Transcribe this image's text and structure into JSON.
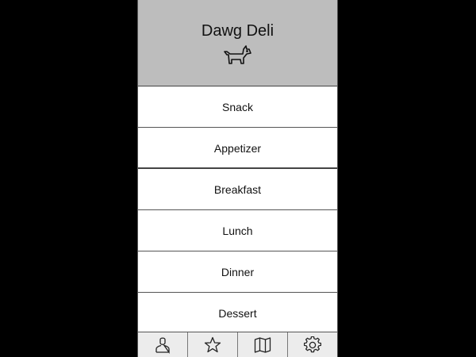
{
  "header": {
    "title": "Dawg Deli",
    "logo_icon": "dog-icon"
  },
  "menu": {
    "items": [
      {
        "label": "Snack"
      },
      {
        "label": "Appetizer"
      },
      {
        "label": "Breakfast"
      },
      {
        "label": "Lunch"
      },
      {
        "label": "Dinner"
      },
      {
        "label": "Dessert"
      }
    ]
  },
  "tabbar": {
    "tabs": [
      {
        "icon": "user-icon"
      },
      {
        "icon": "star-icon"
      },
      {
        "icon": "map-icon"
      },
      {
        "icon": "gear-icon"
      }
    ]
  },
  "colors": {
    "background": "#000000",
    "header": "#bdbdbd",
    "tabbar": "#ececec",
    "text": "#111111"
  }
}
